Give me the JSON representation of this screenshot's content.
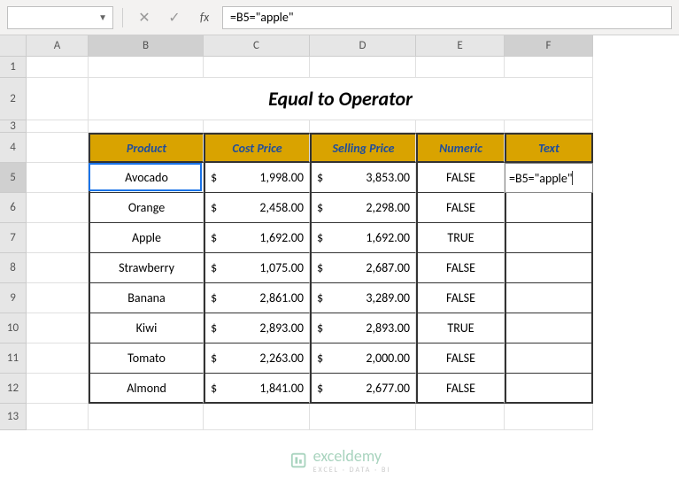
{
  "namebox": "",
  "formula": "=B5=\"apple\"",
  "title": "Equal to Operator",
  "columns": [
    "A",
    "B",
    "C",
    "D",
    "E",
    "F"
  ],
  "rowNumbers": [
    "1",
    "2",
    "3",
    "4",
    "5",
    "6",
    "7",
    "8",
    "9",
    "10",
    "11",
    "12",
    "13"
  ],
  "headers": {
    "product": "Product",
    "cost": "Cost Price",
    "selling": "Selling Price",
    "numeric": "Numeric",
    "text": "Text"
  },
  "rows": [
    {
      "product": "Avocado",
      "cost": "1,998.00",
      "sell": "3,853.00",
      "numeric": "FALSE"
    },
    {
      "product": "Orange",
      "cost": "2,458.00",
      "sell": "2,298.00",
      "numeric": "FALSE"
    },
    {
      "product": "Apple",
      "cost": "1,692.00",
      "sell": "1,692.00",
      "numeric": "TRUE"
    },
    {
      "product": "Strawberry",
      "cost": "1,075.00",
      "sell": "2,687.00",
      "numeric": "FALSE"
    },
    {
      "product": "Banana",
      "cost": "2,861.00",
      "sell": "3,289.00",
      "numeric": "FALSE"
    },
    {
      "product": "Kiwi",
      "cost": "2,893.00",
      "sell": "2,893.00",
      "numeric": "TRUE"
    },
    {
      "product": "Tomato",
      "cost": "2,263.00",
      "sell": "2,000.00",
      "numeric": "FALSE"
    },
    {
      "product": "Almond",
      "cost": "1,841.00",
      "sell": "2,677.00",
      "numeric": "FALSE"
    }
  ],
  "editing": "=B5=\"apple\"",
  "currency": "$",
  "watermark": {
    "brand": "exceldemy",
    "sub": "EXCEL · DATA · BI"
  },
  "colWidths": {
    "A": 70,
    "B": 130,
    "C": 120,
    "D": 120,
    "E": 100,
    "F": 100
  },
  "rowHeights": {
    "1": 24,
    "2": 48,
    "3": 14,
    "4": 34,
    "data": 34,
    "13": 30
  }
}
